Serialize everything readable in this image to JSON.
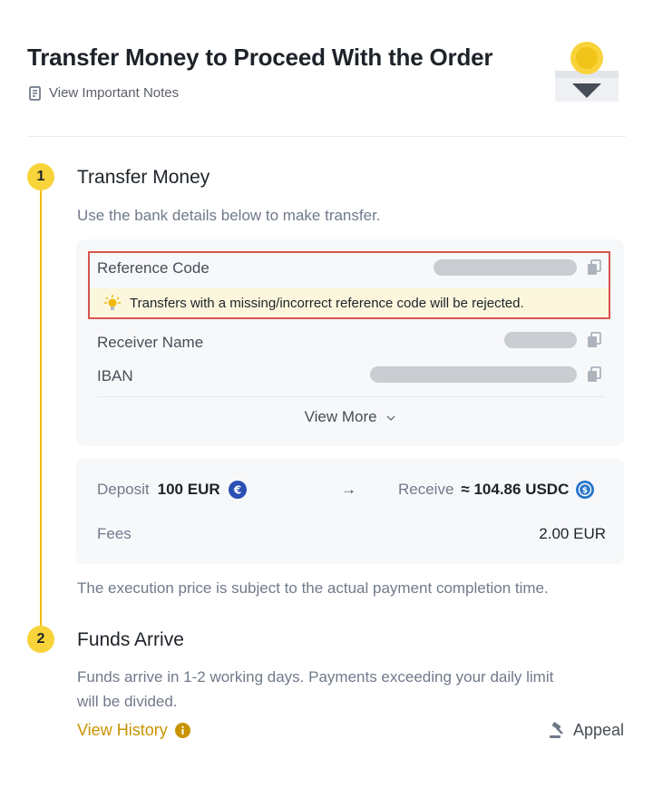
{
  "header": {
    "title": "Transfer Money to Proceed With the Order",
    "notes_link": "View Important Notes"
  },
  "step1": {
    "number": "1",
    "title": "Transfer Money",
    "subtitle": "Use the bank details below to make transfer.",
    "reference_label": "Reference Code",
    "warning": "Transfers with a missing/incorrect reference code will be rejected.",
    "receiver_label": "Receiver Name",
    "iban_label": "IBAN",
    "view_more": "View More"
  },
  "deposit": {
    "deposit_label": "Deposit",
    "deposit_value": "100 EUR",
    "arrow": "→",
    "receive_label": "Receive",
    "receive_value": "≈ 104.86 USDC",
    "fees_label": "Fees",
    "fees_value": "2.00 EUR"
  },
  "execution_note": "The execution price is subject to the actual payment completion time.",
  "step2": {
    "number": "2",
    "title": "Funds Arrive",
    "line1": "Funds arrive in 1-2 working days. Payments exceeding your daily limit",
    "line2": "will be divided."
  },
  "footer": {
    "history_link": "View History",
    "appeal": "Appeal"
  },
  "colors": {
    "accent": "#f0b90b",
    "step_badge": "#f8d33a",
    "warning_border": "#d9534f",
    "warning_bg": "#fcf6dd",
    "link": "#c99400",
    "eur_coin": "#2b4fb3",
    "usdc_coin": "#2775ca"
  }
}
